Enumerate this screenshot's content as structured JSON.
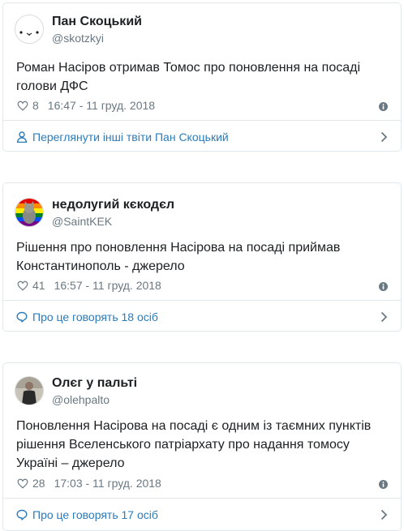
{
  "tweets": [
    {
      "display_name": "Пан Скоцький",
      "handle": "@skotzkyi",
      "text_lines": [
        "Роман Насіров отримав Томос про поновлення на посаді",
        "голови ДФС"
      ],
      "likes": "8",
      "time": "16:47 - 11 груд. 2018",
      "footer": "Переглянути інші твіти Пан Скоцький",
      "footer_icon": "person-icon",
      "avatar": "cat-face-icon"
    },
    {
      "display_name": "недолугий кєкодєл",
      "handle": "@SaintKEK",
      "text_lines": [
        "Рішення про поновлення Насірова на посаді приймав",
        "Константинополь - джерело"
      ],
      "likes": "41",
      "time": "16:57 - 11 груд. 2018",
      "footer": "Про це говорять 18 осіб",
      "footer_icon": "speech-bubble-icon",
      "avatar": "rainbow-cat-icon"
    },
    {
      "display_name": "Олєг у пальті",
      "handle": "@olehpalto",
      "text_lines": [
        "Поновлення Насірова на посаді є одним із таємних пунктів",
        "рішення Вселенського патріархату про надання томосу",
        "Україні – джерело"
      ],
      "likes": "28",
      "time": "17:03 - 11 груд. 2018",
      "footer": "Про це говорять 17 осіб",
      "footer_icon": "speech-bubble-icon",
      "avatar": "person-in-coat-icon"
    }
  ],
  "colors": {
    "link": "#2b7bb9",
    "meta": "#697882",
    "border": "#e1e8ed"
  }
}
